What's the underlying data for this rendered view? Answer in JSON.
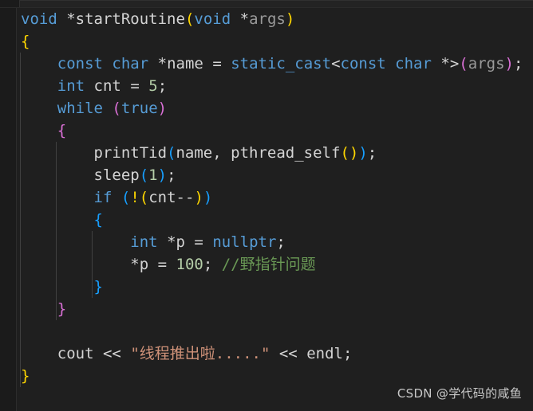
{
  "editor": {
    "background_color": "#1f1f1f",
    "gutter_color": "#1b1b1b",
    "language": "C++",
    "font_size_px": 19,
    "line_height_px": 28
  },
  "theme_colors": {
    "keyword": "#569cd6",
    "identifier": "#d4d4d4",
    "parameter": "#9a9a9a",
    "number": "#b5cea8",
    "string": "#ce9178",
    "comment": "#6a9955",
    "bracket_depth_1": "#ffd700",
    "bracket_depth_2": "#da70d6",
    "bracket_depth_3": "#179fff",
    "indent_guide": "#404040"
  },
  "code": {
    "lines": [
      {
        "indent": 0,
        "text": "void *startRoutine(void *args)"
      },
      {
        "indent": 0,
        "text": "{"
      },
      {
        "indent": 1,
        "text": "const char *name = static_cast<const char *>(args);"
      },
      {
        "indent": 1,
        "text": "int cnt = 5;"
      },
      {
        "indent": 1,
        "text": "while (true)"
      },
      {
        "indent": 1,
        "text": "{"
      },
      {
        "indent": 2,
        "text": "printTid(name, pthread_self());"
      },
      {
        "indent": 2,
        "text": "sleep(1);"
      },
      {
        "indent": 2,
        "text": "if (!(cnt--))"
      },
      {
        "indent": 2,
        "text": "{"
      },
      {
        "indent": 3,
        "text": "int *p = nullptr;"
      },
      {
        "indent": 3,
        "text": "*p = 100; //野指针问题"
      },
      {
        "indent": 2,
        "text": "}"
      },
      {
        "indent": 1,
        "text": "}"
      },
      {
        "indent": 1,
        "text": ""
      },
      {
        "indent": 1,
        "text": "cout << \"线程推出啦.....\" << endl;"
      },
      {
        "indent": 0,
        "text": "}"
      }
    ],
    "tokens": {
      "kw_void": "void",
      "kw_const": "const",
      "kw_char": "char",
      "kw_int": "int",
      "kw_while": "while",
      "kw_if": "if",
      "kw_true": "true",
      "kw_nullptr": "nullptr",
      "kw_static_cast": "static_cast",
      "fn_startRoutine": "startRoutine",
      "fn_printTid": "printTid",
      "fn_pthread_self": "pthread_self",
      "fn_sleep": "sleep",
      "var_args": "args",
      "var_name": "name",
      "var_cnt": "cnt",
      "var_p": "p",
      "var_cout": "cout",
      "var_endl": "endl",
      "num_5": "5",
      "num_1": "1",
      "num_100": "100",
      "string_literal": "\"线程推出啦.....\"",
      "comment_text": "//野指针问题",
      "op_star": "*",
      "op_assign": "=",
      "op_semi": ";",
      "op_comma": ",",
      "op_shift": "<<",
      "op_not": "!",
      "op_dec": "--",
      "op_lt": "<",
      "op_gt": ">",
      "brace_open": "{",
      "brace_close": "}",
      "paren_open": "(",
      "paren_close": ")",
      "space": " "
    }
  },
  "watermark": {
    "text": "CSDN @学代码的咸鱼"
  }
}
